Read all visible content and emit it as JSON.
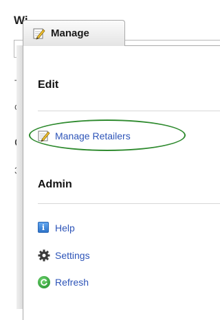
{
  "background": {
    "title_fragment": "Wi",
    "text_fragments": [
      "T",
      "c",
      "C",
      "3"
    ]
  },
  "tab": {
    "label": "Manage",
    "icon": "pencil-paper-icon"
  },
  "sections": {
    "edit": {
      "heading": "Edit",
      "items": [
        {
          "label": "Manage Retailers",
          "icon": "pencil-paper-icon",
          "highlighted": true
        }
      ]
    },
    "admin": {
      "heading": "Admin",
      "items": [
        {
          "label": "Help",
          "icon": "help-icon"
        },
        {
          "label": "Settings",
          "icon": "gear-icon"
        },
        {
          "label": "Refresh",
          "icon": "refresh-icon"
        }
      ]
    }
  },
  "colors": {
    "link": "#2d54b8",
    "highlight_oval": "#2e8a2e",
    "panel_border": "#a9a9a9"
  }
}
